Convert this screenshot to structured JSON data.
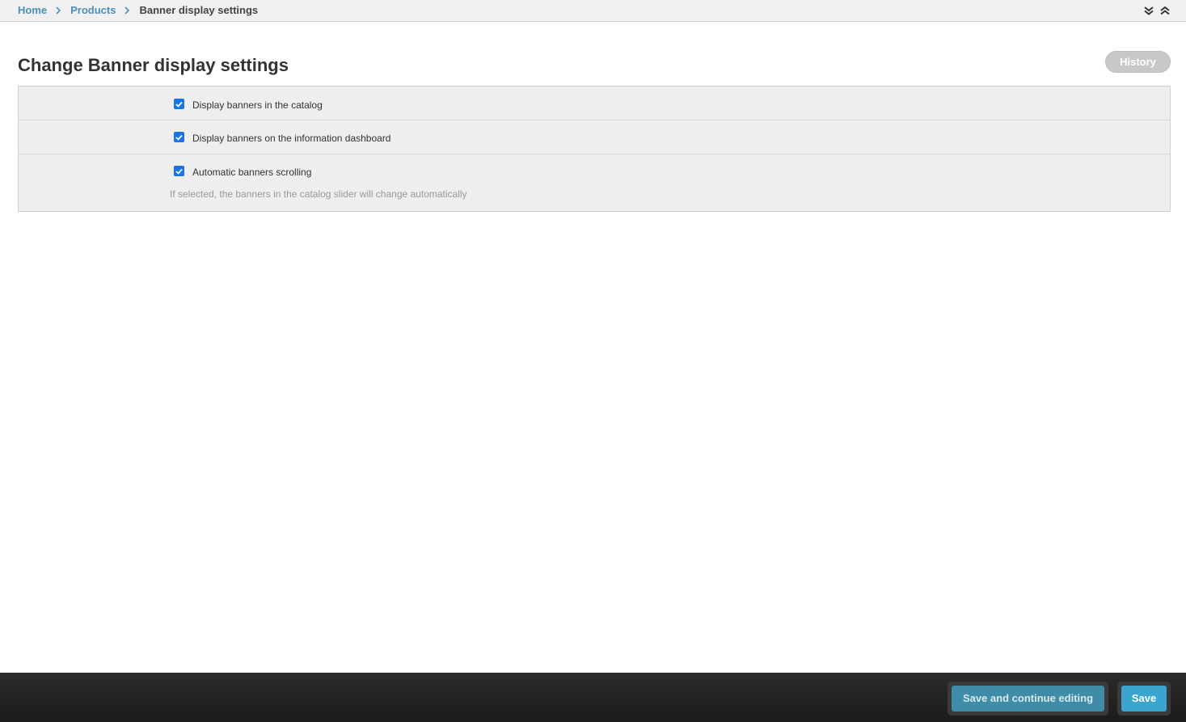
{
  "breadcrumb": {
    "items": [
      {
        "label": "Home"
      },
      {
        "label": "Products"
      }
    ],
    "current": "Banner display settings"
  },
  "header": {
    "title": "Change Banner display settings",
    "history_label": "History"
  },
  "form": {
    "fields": [
      {
        "label": "Display banners in the catalog",
        "checked": true
      },
      {
        "label": "Display banners on the information dashboard",
        "checked": true
      },
      {
        "label": "Automatic banners scrolling",
        "checked": true,
        "help": "If selected, the banners in the catalog slider will change automatically"
      }
    ]
  },
  "footer": {
    "save_continue_label": "Save and continue editing",
    "save_label": "Save"
  },
  "colors": {
    "link": "#4a90b8",
    "checkbox": "#1a73e8",
    "save_button": "#3aa6cf"
  }
}
